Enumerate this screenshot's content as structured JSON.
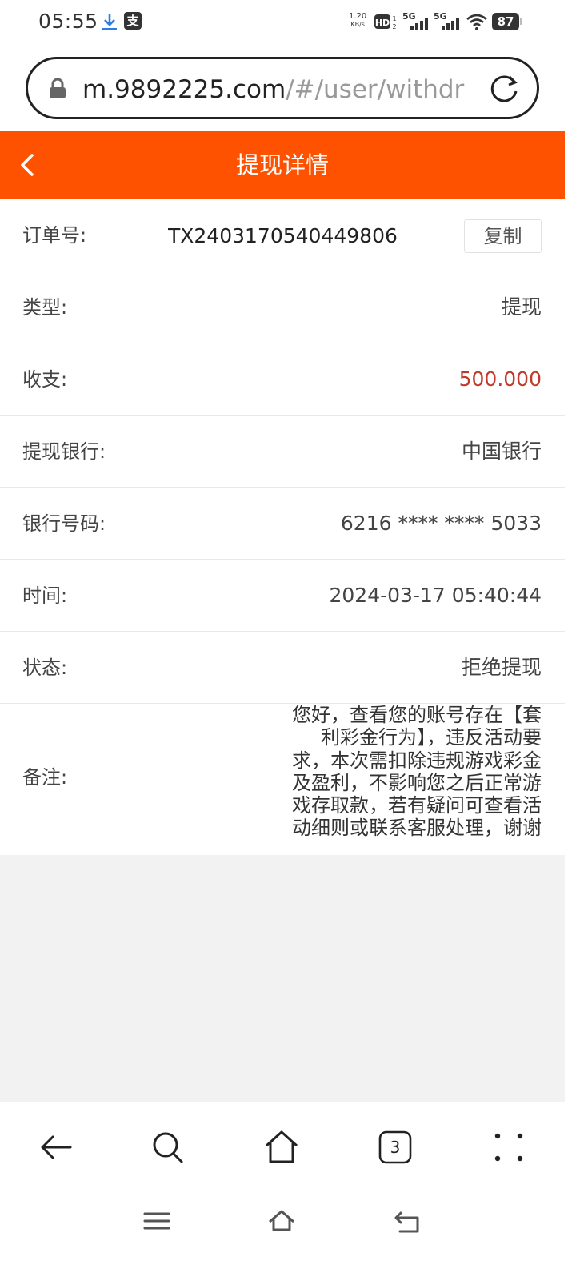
{
  "status_bar": {
    "time": "05:55",
    "speed_value": "1.20",
    "speed_unit": "KB/s",
    "hd_label": "HD",
    "signal1": "5G",
    "signal2": "5G",
    "battery": "87",
    "alipay_char": "支"
  },
  "url_bar": {
    "domain": "m.9892225.com",
    "path": "/#/user/withdraw"
  },
  "header": {
    "title": "提现详情"
  },
  "details": {
    "order_label": "订单号:",
    "order_value": "TX2403170540449806",
    "copy_label": "复制",
    "type_label": "类型:",
    "type_value": "提现",
    "amount_label": "收支:",
    "amount_value": "500.000",
    "bank_label": "提现银行:",
    "bank_value": "中国银行",
    "card_label": "银行号码:",
    "card_value": "6216 **** **** 5033",
    "time_label": "时间:",
    "time_value": "2024-03-17 05:40:44",
    "status_label": "状态:",
    "status_value": "拒绝提现",
    "note_label": "备注:",
    "note_value": "您好，查看您的账号存在【套利彩金行为】，违反活动要求，本次需扣除违规游戏彩金及盈利，不影响您之后正常游戏存取款，若有疑问可查看活动细则或联系客服处理，谢谢"
  },
  "toolbar": {
    "tabs_count": "3"
  },
  "colors": {
    "header_bg": "#ff5200",
    "amount": "#c0392b"
  }
}
